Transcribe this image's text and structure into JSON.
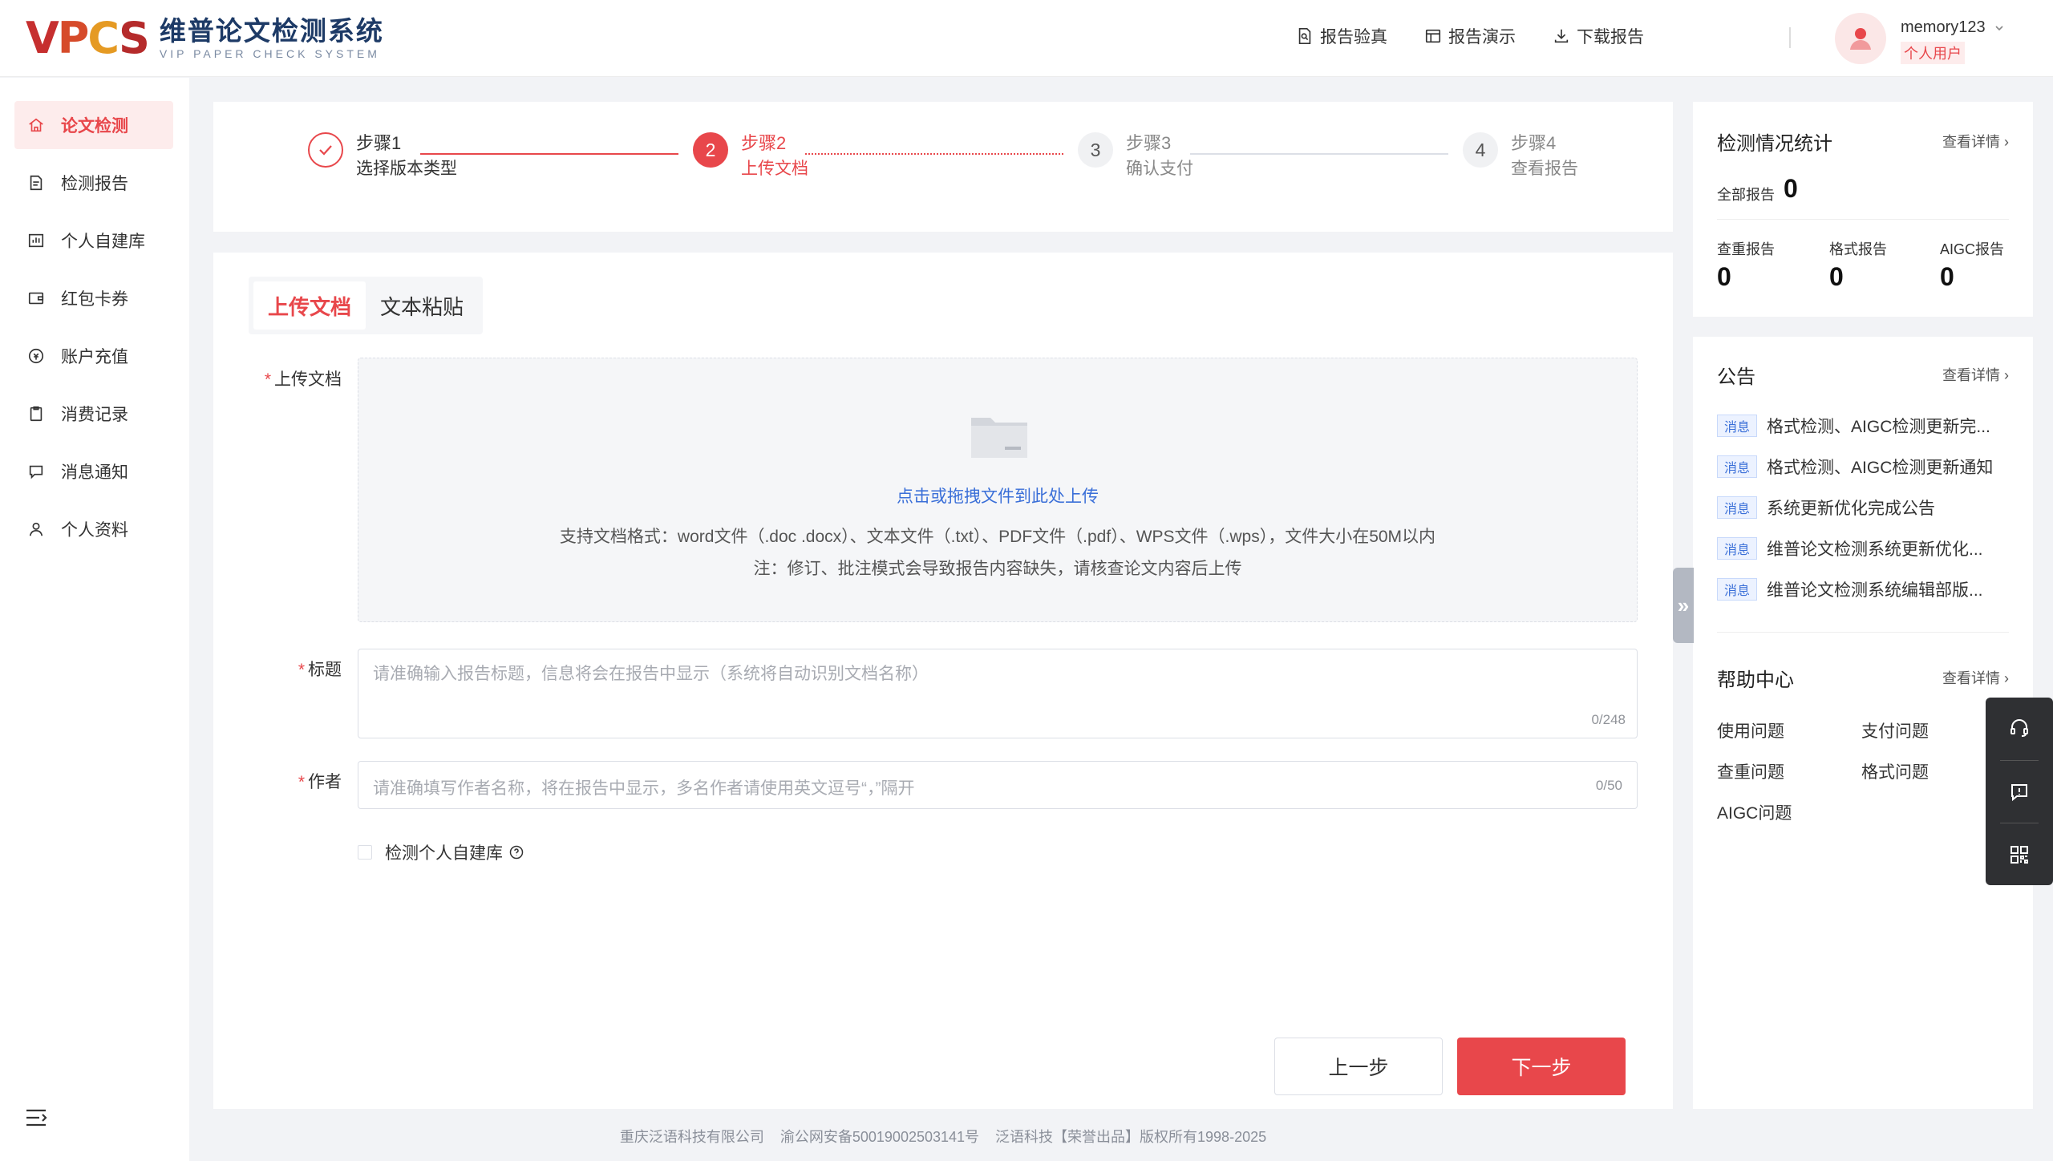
{
  "app": {
    "logo_mark": "VPCS",
    "logo_cn": "维普论文检测系统",
    "logo_en": "VIP PAPER CHECK SYSTEM"
  },
  "header": {
    "links": [
      "报告验真",
      "报告演示",
      "下载报告"
    ],
    "user_name": "memory123",
    "user_type": "个人用户"
  },
  "sidebar": {
    "items": [
      {
        "label": "论文检测",
        "icon": "home-icon",
        "active": true
      },
      {
        "label": "检测报告",
        "icon": "report-icon"
      },
      {
        "label": "个人自建库",
        "icon": "library-icon"
      },
      {
        "label": "红包卡券",
        "icon": "wallet-icon"
      },
      {
        "label": "账户充值",
        "icon": "coin-icon"
      },
      {
        "label": "消费记录",
        "icon": "clipboard-icon"
      },
      {
        "label": "消息通知",
        "icon": "message-icon"
      },
      {
        "label": "个人资料",
        "icon": "user-icon"
      }
    ]
  },
  "steps": [
    {
      "num": "1",
      "title": "步骤1",
      "desc": "选择版本类型",
      "state": "done"
    },
    {
      "num": "2",
      "title": "步骤2",
      "desc": "上传文档",
      "state": "active"
    },
    {
      "num": "3",
      "title": "步骤3",
      "desc": "确认支付",
      "state": "pending"
    },
    {
      "num": "4",
      "title": "步骤4",
      "desc": "查看报告",
      "state": "pending"
    }
  ],
  "form": {
    "tabs": [
      "上传文档",
      "文本粘贴"
    ],
    "upload_label": "上传文档",
    "upload_link": "点击或拖拽文件到此处上传",
    "upload_hint": "支持文档格式：word文件（.doc .docx）、文本文件（.txt）、PDF文件（.pdf）、WPS文件（.wps），文件大小在50M以内",
    "upload_note": "注：修订、批注模式会导致报告内容缺失，请核查论文内容后上传",
    "title_label": "标题",
    "title_placeholder": "请准确输入报告标题，信息将会在报告中显示（系统将自动识别文档名称）",
    "title_count": "0/248",
    "author_label": "作者",
    "author_placeholder": "请准确填写作者名称，将在报告中显示，多名作者请使用英文逗号“，”隔开",
    "author_count": "0/50",
    "checkbox_label": "检测个人自建库",
    "prev_button": "上一步",
    "next_button": "下一步"
  },
  "footer": {
    "copyright": "重庆泛语科技有限公司    渝公网安备50019002503141号    泛语科技【荣誉出品】版权所有1998-2025"
  },
  "stats": {
    "title": "检测情况统计",
    "more": "查看详情",
    "total_label": "全部报告",
    "total_value": "0",
    "items": [
      {
        "label": "查重报告",
        "value": "0"
      },
      {
        "label": "格式报告",
        "value": "0"
      },
      {
        "label": "AIGC报告",
        "value": "0"
      }
    ]
  },
  "notices": {
    "title": "公告",
    "more": "查看详情",
    "tag": "消息",
    "items": [
      "格式检测、AIGC检测更新完...",
      "格式检测、AIGC检测更新通知",
      "系统更新优化完成公告",
      "维普论文检测系统更新优化...",
      "维普论文检测系统编辑部版..."
    ]
  },
  "help": {
    "title": "帮助中心",
    "more": "查看详情",
    "items": [
      "使用问题",
      "支付问题",
      "查重问题",
      "格式问题",
      "AIGC问题"
    ]
  },
  "colors": {
    "accent": "#e8474b",
    "link": "#3a6fd8",
    "logo_navy": "#1d3a66"
  }
}
